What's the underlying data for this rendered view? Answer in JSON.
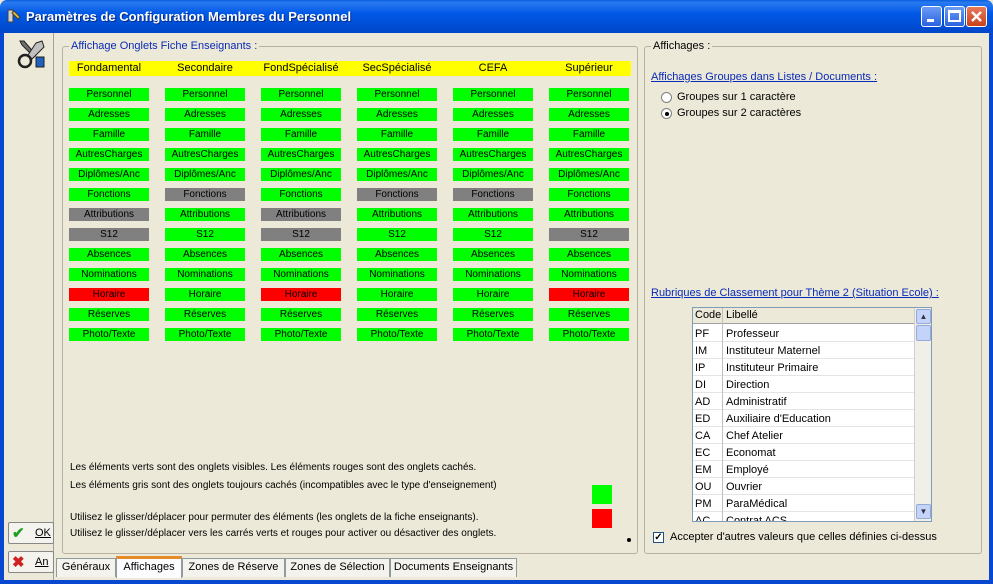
{
  "window": {
    "title": "Paramètres de Configuration Membres du Personnel"
  },
  "colors": {
    "green": "#00ff00",
    "red": "#ff0000",
    "gray": "#808080",
    "header_yellow": "#ffff00",
    "title_blue": "#0a2ab8"
  },
  "left_buttons": {
    "ok_label": "OK",
    "an_label": "An"
  },
  "tabs_group": {
    "title": "Affichage Onglets Fiche Enseignants :",
    "columns": [
      {
        "header": "Fondamental",
        "items": [
          {
            "label": "Personnel",
            "state": "green"
          },
          {
            "label": "Adresses",
            "state": "green"
          },
          {
            "label": "Famille",
            "state": "green"
          },
          {
            "label": "AutresCharges",
            "state": "green"
          },
          {
            "label": "Diplômes/Anc",
            "state": "green"
          },
          {
            "label": "Fonctions",
            "state": "green"
          },
          {
            "label": "Attributions",
            "state": "gray"
          },
          {
            "label": "S12",
            "state": "gray"
          },
          {
            "label": "Absences",
            "state": "green"
          },
          {
            "label": "Nominations",
            "state": "green"
          },
          {
            "label": "Horaire",
            "state": "red"
          },
          {
            "label": "Réserves",
            "state": "green"
          },
          {
            "label": "Photo/Texte",
            "state": "green"
          }
        ]
      },
      {
        "header": "Secondaire",
        "items": [
          {
            "label": "Personnel",
            "state": "green"
          },
          {
            "label": "Adresses",
            "state": "green"
          },
          {
            "label": "Famille",
            "state": "green"
          },
          {
            "label": "AutresCharges",
            "state": "green"
          },
          {
            "label": "Diplômes/Anc",
            "state": "green"
          },
          {
            "label": "Fonctions",
            "state": "gray"
          },
          {
            "label": "Attributions",
            "state": "green"
          },
          {
            "label": "S12",
            "state": "green"
          },
          {
            "label": "Absences",
            "state": "green"
          },
          {
            "label": "Nominations",
            "state": "green"
          },
          {
            "label": "Horaire",
            "state": "green"
          },
          {
            "label": "Réserves",
            "state": "green"
          },
          {
            "label": "Photo/Texte",
            "state": "green"
          }
        ]
      },
      {
        "header": "FondSpécialisé",
        "items": [
          {
            "label": "Personnel",
            "state": "green"
          },
          {
            "label": "Adresses",
            "state": "green"
          },
          {
            "label": "Famille",
            "state": "green"
          },
          {
            "label": "AutresCharges",
            "state": "green"
          },
          {
            "label": "Diplômes/Anc",
            "state": "green"
          },
          {
            "label": "Fonctions",
            "state": "green"
          },
          {
            "label": "Attributions",
            "state": "gray"
          },
          {
            "label": "S12",
            "state": "gray"
          },
          {
            "label": "Absences",
            "state": "green"
          },
          {
            "label": "Nominations",
            "state": "green"
          },
          {
            "label": "Horaire",
            "state": "red"
          },
          {
            "label": "Réserves",
            "state": "green"
          },
          {
            "label": "Photo/Texte",
            "state": "green"
          }
        ]
      },
      {
        "header": "SecSpécialisé",
        "items": [
          {
            "label": "Personnel",
            "state": "green"
          },
          {
            "label": "Adresses",
            "state": "green"
          },
          {
            "label": "Famille",
            "state": "green"
          },
          {
            "label": "AutresCharges",
            "state": "green"
          },
          {
            "label": "Diplômes/Anc",
            "state": "green"
          },
          {
            "label": "Fonctions",
            "state": "gray"
          },
          {
            "label": "Attributions",
            "state": "green"
          },
          {
            "label": "S12",
            "state": "green"
          },
          {
            "label": "Absences",
            "state": "green"
          },
          {
            "label": "Nominations",
            "state": "green"
          },
          {
            "label": "Horaire",
            "state": "green"
          },
          {
            "label": "Réserves",
            "state": "green"
          },
          {
            "label": "Photo/Texte",
            "state": "green"
          }
        ]
      },
      {
        "header": "CEFA",
        "items": [
          {
            "label": "Personnel",
            "state": "green"
          },
          {
            "label": "Adresses",
            "state": "green"
          },
          {
            "label": "Famille",
            "state": "green"
          },
          {
            "label": "AutresCharges",
            "state": "green"
          },
          {
            "label": "Diplômes/Anc",
            "state": "green"
          },
          {
            "label": "Fonctions",
            "state": "gray"
          },
          {
            "label": "Attributions",
            "state": "green"
          },
          {
            "label": "S12",
            "state": "green"
          },
          {
            "label": "Absences",
            "state": "green"
          },
          {
            "label": "Nominations",
            "state": "green"
          },
          {
            "label": "Horaire",
            "state": "green"
          },
          {
            "label": "Réserves",
            "state": "green"
          },
          {
            "label": "Photo/Texte",
            "state": "green"
          }
        ]
      },
      {
        "header": "Supérieur",
        "items": [
          {
            "label": "Personnel",
            "state": "green"
          },
          {
            "label": "Adresses",
            "state": "green"
          },
          {
            "label": "Famille",
            "state": "green"
          },
          {
            "label": "AutresCharges",
            "state": "green"
          },
          {
            "label": "Diplômes/Anc",
            "state": "green"
          },
          {
            "label": "Fonctions",
            "state": "green"
          },
          {
            "label": "Attributions",
            "state": "green"
          },
          {
            "label": "S12",
            "state": "gray"
          },
          {
            "label": "Absences",
            "state": "green"
          },
          {
            "label": "Nominations",
            "state": "green"
          },
          {
            "label": "Horaire",
            "state": "red"
          },
          {
            "label": "Réserves",
            "state": "green"
          },
          {
            "label": "Photo/Texte",
            "state": "green"
          }
        ]
      }
    ],
    "legend": {
      "line1": "Les éléments verts sont des onglets visibles.  Les éléments rouges sont des onglets cachés.",
      "line2": "Les éléments gris sont des onglets toujours cachés (incompatibles avec le type d'enseignement)",
      "line3": "Utilisez le glisser/déplacer pour permuter des éléments (les onglets de la fiche enseignants).",
      "line4": "Utilisez le glisser/déplacer vers les carrés verts et rouges pour activer ou désactiver des onglets."
    }
  },
  "affichages": {
    "title": "Affichages :",
    "groupes_title": "Affichages Groupes dans Listes / Documents :",
    "radio_options": [
      {
        "label": "Groupes sur 1 caractère",
        "selected": false
      },
      {
        "label": "Groupes sur 2 caractères",
        "selected": true
      }
    ],
    "rubriques_title": "Rubriques de Classement pour Thème 2 (Situation Ecole) :",
    "list_headers": {
      "code": "Code",
      "libelle": "Libellé"
    },
    "list_rows": [
      {
        "code": "PF",
        "libelle": "Professeur"
      },
      {
        "code": "IM",
        "libelle": "Instituteur Maternel"
      },
      {
        "code": "IP",
        "libelle": "Instituteur Primaire"
      },
      {
        "code": "DI",
        "libelle": "Direction"
      },
      {
        "code": "AD",
        "libelle": "Administratif"
      },
      {
        "code": "ED",
        "libelle": "Auxiliaire d'Education"
      },
      {
        "code": "CA",
        "libelle": "Chef Atelier"
      },
      {
        "code": "EC",
        "libelle": "Economat"
      },
      {
        "code": "EM",
        "libelle": "Employé"
      },
      {
        "code": "OU",
        "libelle": "Ouvrier"
      },
      {
        "code": "PM",
        "libelle": "ParaMédical"
      },
      {
        "code": "AC",
        "libelle": "Contrat ACS"
      }
    ],
    "accept_label": "Accepter d'autres valeurs que celles définies ci-dessus",
    "accept_checked": true
  },
  "bottom_tabs": [
    {
      "label": "Généraux",
      "active": false
    },
    {
      "label": "Affichages",
      "active": true
    },
    {
      "label": "Zones de Réserve",
      "active": false
    },
    {
      "label": "Zones de Sélection",
      "active": false
    },
    {
      "label": "Documents Enseignants",
      "active": false
    }
  ]
}
